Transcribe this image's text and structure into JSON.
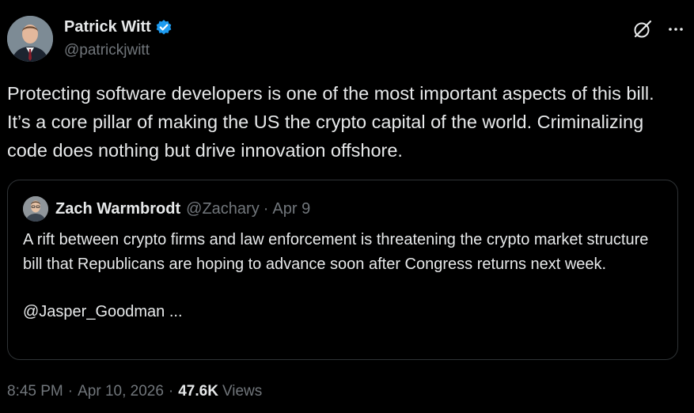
{
  "author": {
    "display_name": "Patrick Witt",
    "handle": "@patrickjwitt",
    "verified_color": "#1d9bf0"
  },
  "post": {
    "text": "Protecting software developers is one of the most important aspects of this bill. It’s a core pillar of making the US the crypto capital of the world. Criminalizing code does nothing but drive innovation offshore."
  },
  "quote": {
    "display_name": "Zach Warmbrodt",
    "handle": "@Zachary",
    "separator": "·",
    "date": "Apr 9",
    "paragraph_1": "A rift between crypto firms and law enforcement is threatening the crypto market structure bill that Republicans are hoping to advance soon after Congress returns next week.",
    "paragraph_2": "@Jasper_Goodman ..."
  },
  "meta": {
    "time": "8:45 PM",
    "separator": "·",
    "date": "Apr 10, 2026",
    "views_count": "47.6K",
    "views_label": "Views"
  },
  "icons": {
    "grok": "grok-icon",
    "more": "more-icon",
    "verified": "verified-badge-icon"
  }
}
